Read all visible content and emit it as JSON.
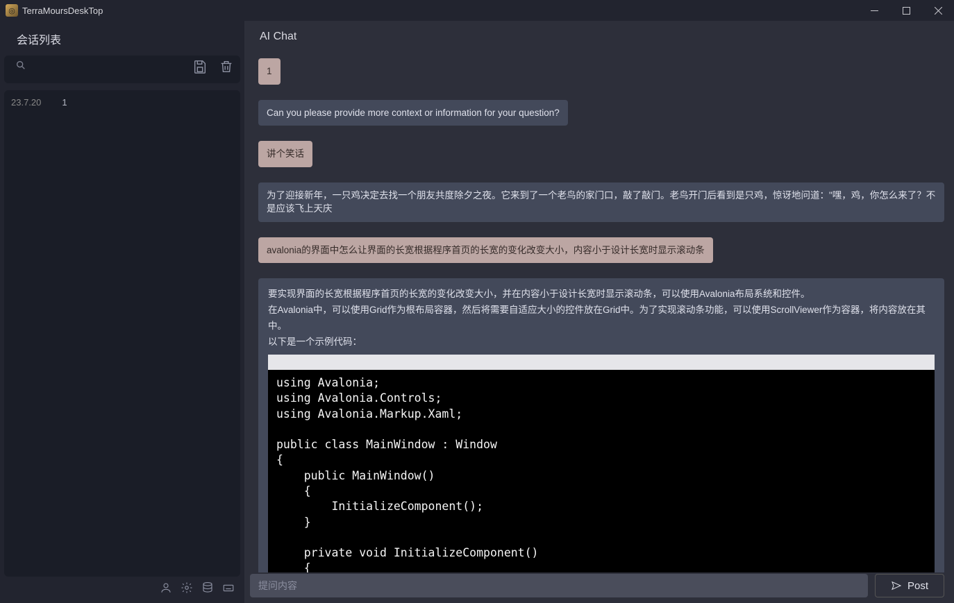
{
  "window": {
    "title": "TerraMoursDeskTop"
  },
  "sidebar": {
    "header": "会话列表",
    "items": [
      {
        "date": "23.7.20",
        "title": "1"
      }
    ]
  },
  "chat": {
    "header": "AI Chat",
    "messages": [
      {
        "role": "user",
        "text": "1"
      },
      {
        "role": "assistant",
        "text": "Can you please provide more context or information for your question?"
      },
      {
        "role": "user",
        "text": "讲个笑话"
      },
      {
        "role": "assistant",
        "text": "为了迎接新年，一只鸡决定去找一个朋友共度除夕之夜。它来到了一个老鸟的家门口，敲了敲门。老鸟开门后看到是只鸡，惊讶地问道：\"嘿，鸡，你怎么来了？不是应该飞上天庆"
      },
      {
        "role": "user",
        "text": "avalonia的界面中怎么让界面的长宽根据程序首页的长宽的变化改变大小，内容小于设计长宽时显示滚动条"
      },
      {
        "role": "assistant_block",
        "intro_lines": [
          "要实现界面的长宽根据程序首页的长宽的变化改变大小，并在内容小于设计长宽时显示滚动条，可以使用Avalonia布局系统和控件。",
          "在Avalonia中，可以使用Grid作为根布局容器，然后将需要自适应大小的控件放在Grid中。为了实现滚动条功能，可以使用ScrollViewer作为容器，将内容放在其中。",
          "以下是一个示例代码："
        ],
        "code": "using Avalonia;\nusing Avalonia.Controls;\nusing Avalonia.Markup.Xaml;\n\npublic class MainWindow : Window\n{\n    public MainWindow()\n    {\n        InitializeComponent();\n    }\n\n    private void InitializeComponent()\n    {\n        AvaloniaXamlLoader.Load(this);"
      }
    ],
    "input_placeholder": "提问内容",
    "post_label": "Post",
    "icons": {
      "search": "search-icon",
      "save": "save-icon",
      "trash": "trash-icon",
      "user": "user-icon",
      "gear": "gear-icon",
      "database": "database-icon",
      "keyboard": "keyboard-icon",
      "send": "send-icon"
    }
  }
}
